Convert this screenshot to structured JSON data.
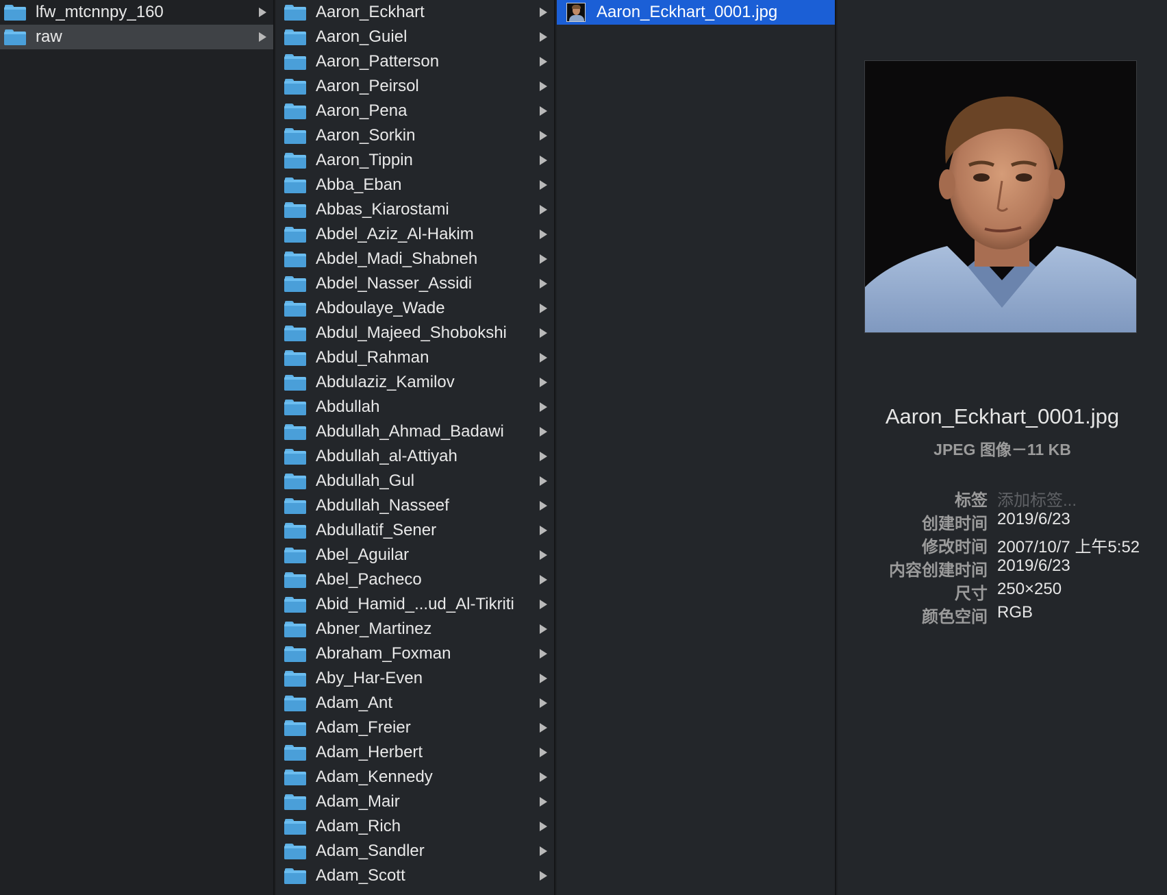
{
  "column1": {
    "items": [
      {
        "label": "lfw_mtcnnpy_160",
        "selected": false
      },
      {
        "label": "raw",
        "selected": true
      }
    ]
  },
  "column2": {
    "items": [
      "Aaron_Eckhart",
      "Aaron_Guiel",
      "Aaron_Patterson",
      "Aaron_Peirsol",
      "Aaron_Pena",
      "Aaron_Sorkin",
      "Aaron_Tippin",
      "Abba_Eban",
      "Abbas_Kiarostami",
      "Abdel_Aziz_Al-Hakim",
      "Abdel_Madi_Shabneh",
      "Abdel_Nasser_Assidi",
      "Abdoulaye_Wade",
      "Abdul_Majeed_Shobokshi",
      "Abdul_Rahman",
      "Abdulaziz_Kamilov",
      "Abdullah",
      "Abdullah_Ahmad_Badawi",
      "Abdullah_al-Attiyah",
      "Abdullah_Gul",
      "Abdullah_Nasseef",
      "Abdullatif_Sener",
      "Abel_Aguilar",
      "Abel_Pacheco",
      "Abid_Hamid_...ud_Al-Tikriti",
      "Abner_Martinez",
      "Abraham_Foxman",
      "Aby_Har-Even",
      "Adam_Ant",
      "Adam_Freier",
      "Adam_Herbert",
      "Adam_Kennedy",
      "Adam_Mair",
      "Adam_Rich",
      "Adam_Sandler",
      "Adam_Scott"
    ],
    "selected_index": 0
  },
  "column3": {
    "items": [
      {
        "label": "Aaron_Eckhart_0001.jpg",
        "selected": true
      }
    ]
  },
  "preview": {
    "filename": "Aaron_Eckhart_0001.jpg",
    "kind": "JPEG 图像－11 KB",
    "info": [
      {
        "key": "标签",
        "value": "添加标签...",
        "placeholder": true
      },
      {
        "key": "创建时间",
        "value": "2019/6/23"
      },
      {
        "key": "修改时间",
        "value": "2007/10/7 上午5:52"
      },
      {
        "key": "内容创建时间",
        "value": "2019/6/23"
      },
      {
        "key": "尺寸",
        "value": "250×250"
      },
      {
        "key": "颜色空间",
        "value": "RGB"
      }
    ]
  },
  "colors": {
    "selection_blue": "#1b5fd6",
    "selection_gray": "#3f4246",
    "folder_blue": "#6bbdf0",
    "background": "#23262a"
  }
}
